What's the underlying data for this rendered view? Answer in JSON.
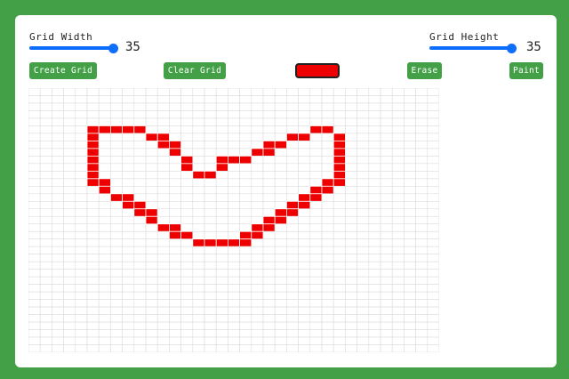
{
  "controls": {
    "grid_width": {
      "label": "Grid Width",
      "value": "35"
    },
    "grid_height": {
      "label": "Grid Height",
      "value": "35"
    }
  },
  "buttons": {
    "create": "Create Grid",
    "clear": "Clear Grid",
    "erase": "Erase",
    "paint": "Paint"
  },
  "color_picker": {
    "value": "#ee0000"
  },
  "grid": {
    "columns": 35,
    "rows": 35,
    "empty_color": "#ffffff",
    "line_color": "#dcdcdc",
    "paint_color": "#ee0000",
    "painted_cells": [
      [
        5,
        5
      ],
      [
        6,
        5
      ],
      [
        7,
        5
      ],
      [
        8,
        5
      ],
      [
        9,
        5
      ],
      [
        10,
        6
      ],
      [
        11,
        6
      ],
      [
        11,
        7
      ],
      [
        12,
        7
      ],
      [
        12,
        8
      ],
      [
        13,
        9
      ],
      [
        13,
        10
      ],
      [
        14,
        11
      ],
      [
        15,
        11
      ],
      [
        16,
        10
      ],
      [
        16,
        9
      ],
      [
        17,
        9
      ],
      [
        18,
        9
      ],
      [
        19,
        8
      ],
      [
        20,
        8
      ],
      [
        20,
        7
      ],
      [
        21,
        7
      ],
      [
        22,
        6
      ],
      [
        23,
        6
      ],
      [
        24,
        5
      ],
      [
        25,
        5
      ],
      [
        26,
        6
      ],
      [
        26,
        7
      ],
      [
        26,
        8
      ],
      [
        26,
        9
      ],
      [
        26,
        10
      ],
      [
        26,
        11
      ],
      [
        26,
        12
      ],
      [
        25,
        12
      ],
      [
        25,
        13
      ],
      [
        24,
        13
      ],
      [
        24,
        14
      ],
      [
        23,
        14
      ],
      [
        23,
        15
      ],
      [
        22,
        15
      ],
      [
        22,
        16
      ],
      [
        21,
        16
      ],
      [
        21,
        17
      ],
      [
        20,
        17
      ],
      [
        20,
        18
      ],
      [
        19,
        18
      ],
      [
        19,
        19
      ],
      [
        18,
        19
      ],
      [
        18,
        20
      ],
      [
        17,
        20
      ],
      [
        16,
        20
      ],
      [
        15,
        20
      ],
      [
        14,
        20
      ],
      [
        13,
        19
      ],
      [
        12,
        19
      ],
      [
        12,
        18
      ],
      [
        11,
        18
      ],
      [
        10,
        17
      ],
      [
        10,
        16
      ],
      [
        9,
        16
      ],
      [
        9,
        15
      ],
      [
        8,
        15
      ],
      [
        8,
        14
      ],
      [
        7,
        14
      ],
      [
        6,
        13
      ],
      [
        5,
        12
      ],
      [
        5,
        11
      ],
      [
        5,
        10
      ],
      [
        5,
        9
      ],
      [
        5,
        8
      ],
      [
        5,
        7
      ],
      [
        5,
        6
      ],
      [
        6,
        12
      ]
    ]
  }
}
